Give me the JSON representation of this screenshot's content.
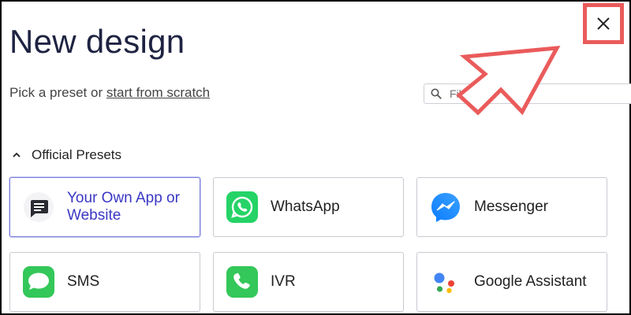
{
  "dialog": {
    "title": "New design",
    "subtitle_prefix": "Pick a preset or ",
    "subtitle_link": "start from scratch",
    "filter_placeholder": "Filter",
    "close_icon": "close-icon"
  },
  "section": {
    "label": "Official Presets",
    "icon": "chevron-up-icon"
  },
  "presets": [
    {
      "label": "Your Own App or Website",
      "icon": "chat-bubble-icon",
      "selected": true
    },
    {
      "label": "WhatsApp",
      "icon": "whatsapp-icon",
      "selected": false
    },
    {
      "label": "Messenger",
      "icon": "messenger-icon",
      "selected": false
    },
    {
      "label": "SMS",
      "icon": "sms-icon",
      "selected": false
    },
    {
      "label": "IVR",
      "icon": "phone-icon",
      "selected": false
    },
    {
      "label": "Google Assistant",
      "icon": "google-assistant-icon",
      "selected": false
    }
  ],
  "annotation": {
    "highlight_color": "#ea5b5b",
    "shape": "arrow-pointing-to-close-button"
  },
  "colors": {
    "title": "#1f2342",
    "selected_text": "#3a37c4",
    "whatsapp": "#25d366",
    "messenger": "#1877f2",
    "sms": "#34c759"
  }
}
